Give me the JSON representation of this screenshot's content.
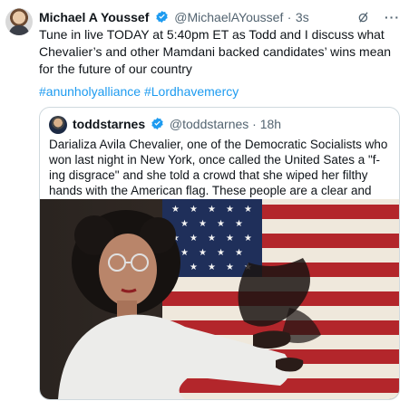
{
  "tweet": {
    "author_name": "Michael A Youssef",
    "handle": "@MichaelAYoussef",
    "separator": "·",
    "time": "3s",
    "text": "Tune in live TODAY at 5:40pm ET as Todd and I discuss what Chevalier’s and other Mamdani backed candidates’ wins mean for the future of our country",
    "hashtags": "#anunholyalliance #Lordhavemercy"
  },
  "quote": {
    "author_name": "toddstarnes",
    "handle": "@toddstarnes",
    "separator": "·",
    "time": "18h",
    "text": "Darializa Avila Chevalier, one of the Democratic Socialists who won last night in New York, once called the United Sates a \"f-ing disgrace\" and she told a crowd that she wiped her filthy hands with the American flag. These people are a clear and present danger to the Republic."
  },
  "icons": {
    "verified": "verified-badge-icon",
    "grok": "grok-icon",
    "more": "more-icon"
  },
  "colors": {
    "text": "#0f1419",
    "secondary": "#536471",
    "link": "#1d9bf0",
    "verified": "#1d9bf0",
    "border": "#cfd9de"
  }
}
